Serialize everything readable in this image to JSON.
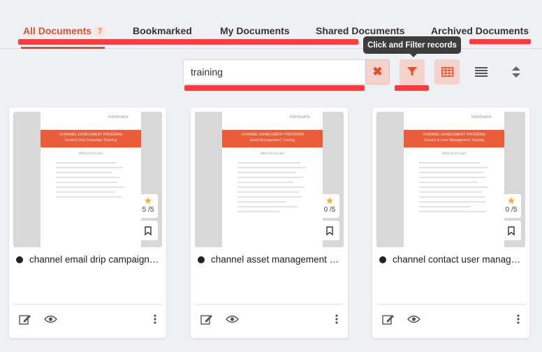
{
  "tabs": [
    {
      "label": "All Documents",
      "badge": "7",
      "active": true
    },
    {
      "label": "Bookmarked"
    },
    {
      "label": "My Documents"
    },
    {
      "label": "Shared Documents"
    },
    {
      "label": "Archived Documents"
    }
  ],
  "tooltip": {
    "text": "Click and Filter records"
  },
  "search": {
    "value": "training"
  },
  "toolbar": {
    "clear_icon": "close-icon",
    "filter_icon": "filter-icon",
    "grid_icon": "grid-view-icon",
    "list_icon": "list-view-icon",
    "sort_icon": "sort-icon"
  },
  "colors": {
    "accent": "#e2512a",
    "annotation_red": "#ff3a3f",
    "banner": "#ea5d3a"
  },
  "cards": [
    {
      "title": "channel email drip campaign ...",
      "rating": "5 /5",
      "preview": {
        "logo": "mindmatrix",
        "banner_line1": "CHANNEL ENABLEMENT PROGRAM",
        "banner_line2": "Email & Drip Campaign Training",
        "subheading": "What You'll Learn"
      }
    },
    {
      "title": "channel asset management tr...",
      "rating": "0 /5",
      "preview": {
        "logo": "mindmatrix",
        "banner_line1": "CHANNEL ENABLEMENT PROGRAM",
        "banner_line2": "Asset Management Training",
        "subheading": "What You'll Learn"
      }
    },
    {
      "title": "channel contact user manage...",
      "rating": "0 /5",
      "preview": {
        "logo": "mindmatrix",
        "banner_line1": "CHANNEL ENABLEMENT PROGRAM",
        "banner_line2": "Contact & User Management Training",
        "subheading": "What You'll Learn"
      }
    }
  ]
}
